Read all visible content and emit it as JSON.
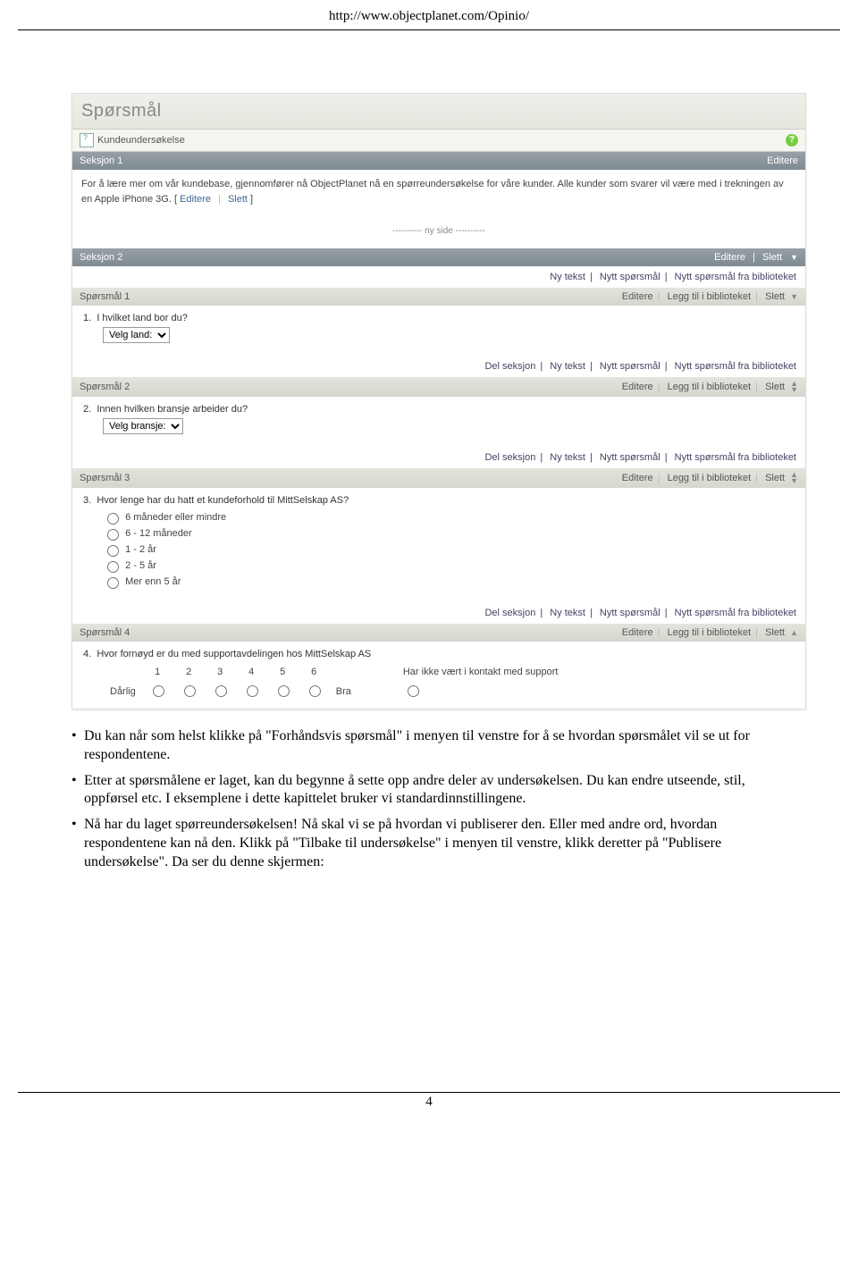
{
  "header": {
    "url": "http://www.objectplanet.com/Opinio/"
  },
  "screenshot": {
    "title": "Spørsmål",
    "survey_name": "Kundeundersøkelse",
    "section1": {
      "title": "Seksjon 1",
      "edit": "Editere",
      "body_text": "For å lære mer om vår kundebase, gjennomfører nå ObjectPlanet nå en spørreundersøkelse for våre kunder. Alle kunder som svarer vil være med i trekningen av en Apple iPhone 3G. ",
      "edit2": "Editere",
      "delete": "Slett"
    },
    "page_sep": "---------- ny side ----------",
    "section2": {
      "title": "Seksjon 2",
      "edit": "Editere",
      "delete": "Slett"
    },
    "actions": {
      "del_seksjon": "Del seksjon",
      "ny_tekst": "Ny tekst",
      "nytt_sporsmal": "Nytt spørsmål",
      "nytt_sporsmal_bib": "Nytt spørsmål fra biblioteket"
    },
    "q_actions": {
      "editere": "Editere",
      "legg_til": "Legg til i biblioteket",
      "slett": "Slett"
    },
    "q1": {
      "title": "Spørsmål 1",
      "num": "1.",
      "text": "I hvilket land bor du?",
      "select": "Velg land:"
    },
    "q2": {
      "title": "Spørsmål 2",
      "num": "2.",
      "text": "Innen hvilken bransje arbeider du?",
      "select": "Velg bransje:"
    },
    "q3": {
      "title": "Spørsmål 3",
      "num": "3.",
      "text": "Hvor lenge har du hatt et kundeforhold til MittSelskap AS?",
      "options": [
        "6 måneder eller mindre",
        "6 - 12 måneder",
        "1 - 2 år",
        "2 - 5 år",
        "Mer enn 5 år"
      ]
    },
    "q4": {
      "title": "Spørsmål 4",
      "num": "4.",
      "text": "Hvor fornøyd er du med supportavdelingen hos MittSelskap AS",
      "scale": [
        "1",
        "2",
        "3",
        "4",
        "5",
        "6"
      ],
      "left": "Dårlig",
      "right": "Bra",
      "na": "Har ikke vært i kontakt med support"
    }
  },
  "doc": {
    "bullet1": "Du kan når som helst klikke på \"Forhåndsvis spørsmål\" i menyen til venstre for å se hvordan spørsmålet vil se ut for respondentene.",
    "bullet2": "Etter at spørsmålene er laget, kan du begynne å sette opp andre deler av undersøkelsen. Du kan endre utseende, stil, oppførsel etc. I eksemplene i dette kapittelet bruker vi standardinnstillingene.",
    "bullet3": "Nå har du laget spørreundersøkelsen! Nå skal vi se på hvordan vi publiserer den. Eller med andre ord, hvordan respondentene kan nå den. Klikk på \"Tilbake til undersøkelse\" i menyen til venstre, klikk deretter på \"Publisere undersøkelse\". Da ser du denne skjermen:"
  },
  "footer": {
    "page_number": "4"
  }
}
